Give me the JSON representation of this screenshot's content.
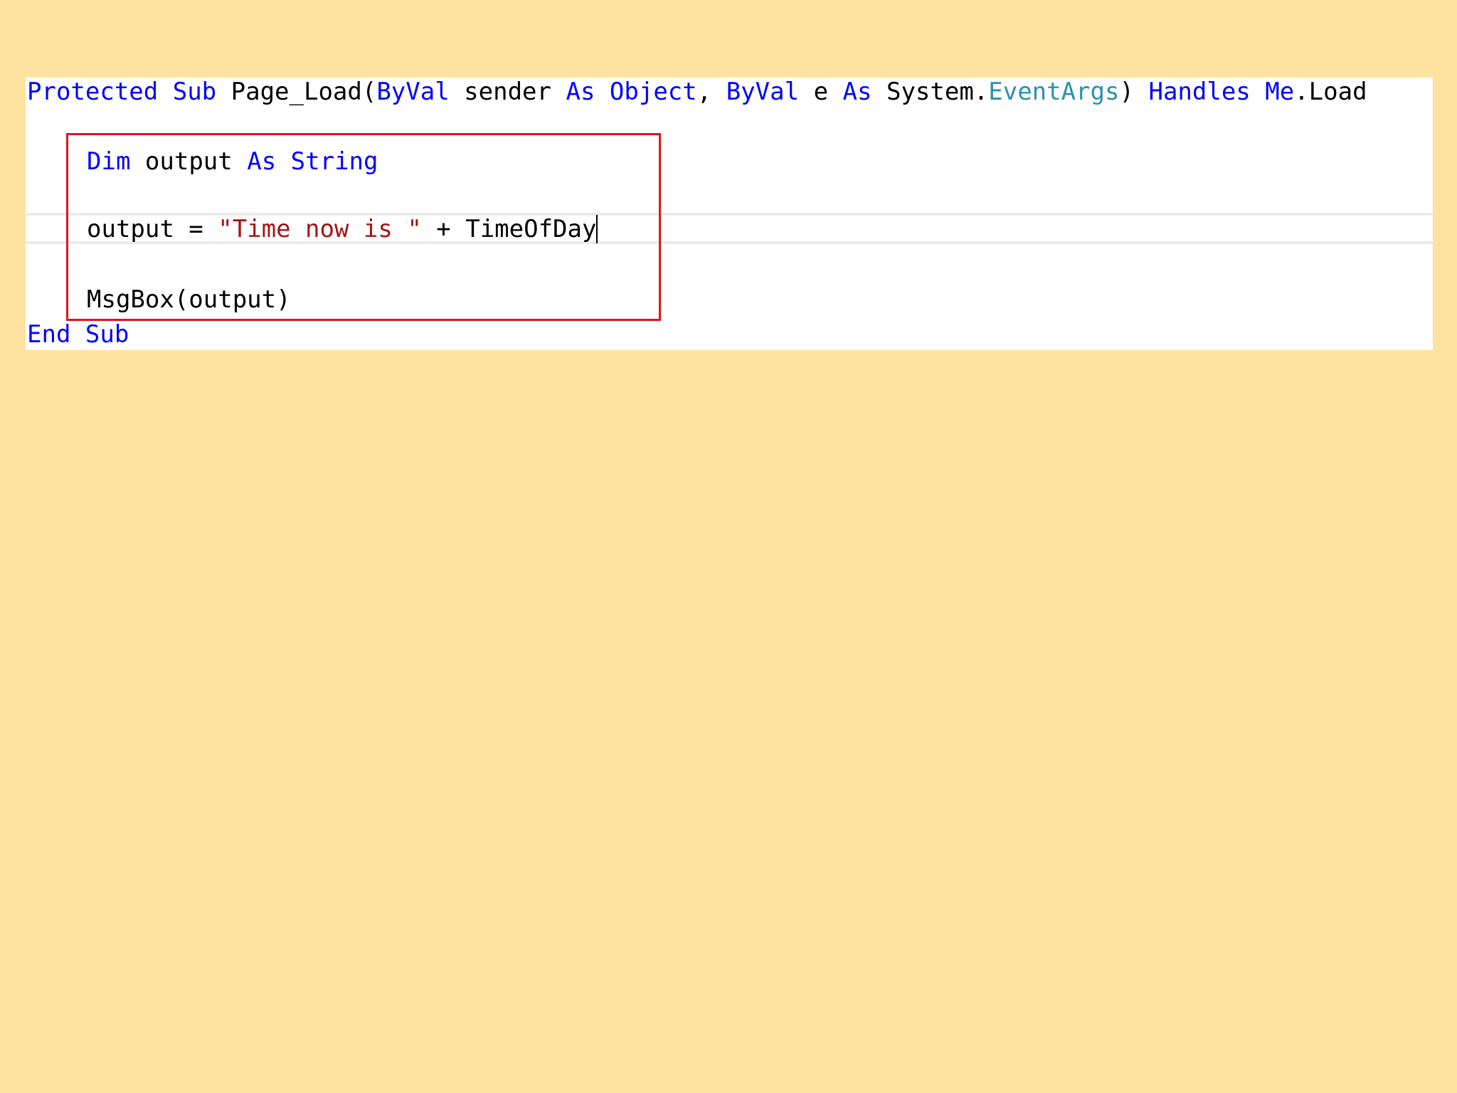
{
  "editor": {
    "line1": {
      "t1": "Protected",
      "t2": "Sub",
      "t3": "Page_Load(",
      "t4": "ByVal",
      "t5": "sender",
      "t6": "As",
      "t7": "Object",
      "t8": ",",
      "t9": "ByVal",
      "t10": "e",
      "t11": "As",
      "t12": "System.",
      "t13": "EventArgs",
      "t14": ")",
      "t15": "Handles",
      "t16": "Me",
      "t17": ".Load"
    },
    "line2": {
      "t1": "Dim",
      "t2": "output",
      "t3": "As",
      "t4": "String"
    },
    "line3": {
      "t1": "output = ",
      "t2": "\"Time now is \"",
      "t3": " + TimeOfDay"
    },
    "line4": {
      "t1": "MsgBox(output)"
    },
    "line5": {
      "t1": "End",
      "t2": "Sub"
    }
  },
  "colors": {
    "background": "#fee29f",
    "keyword": "#0000ff",
    "type": "#2b91af",
    "string": "#a31515",
    "highlight_border": "#e3131b"
  }
}
